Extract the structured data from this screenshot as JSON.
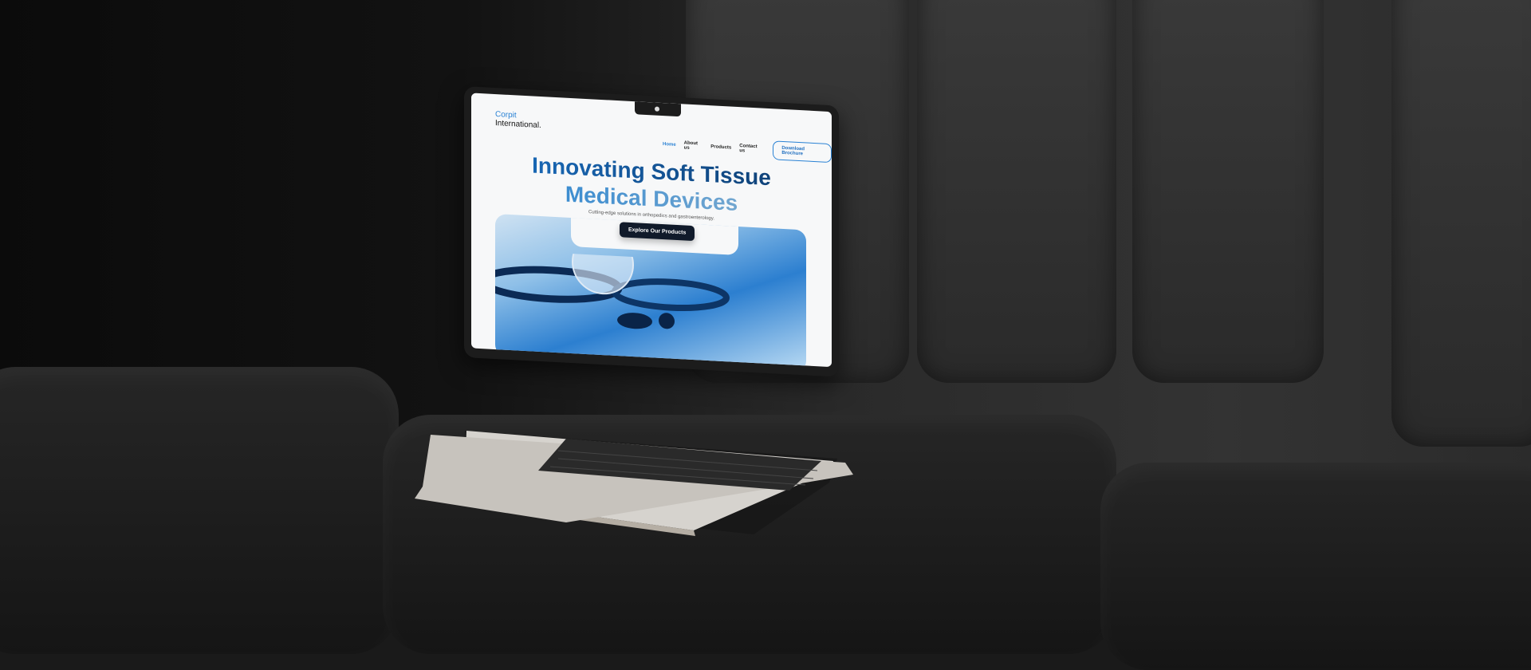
{
  "site": {
    "logo": {
      "line1": "Corpit",
      "line2": "International."
    },
    "nav": {
      "items": [
        "Home",
        "About us",
        "Products",
        "Contact us"
      ],
      "active": "Home",
      "download_label": "Download Brochure"
    },
    "hero": {
      "title_line1": "Innovating Soft Tissue",
      "title_line2": "Medical Devices",
      "subtitle": "Cutting-edge solutions in orthopedics and gastroenterology.",
      "cta_label": "Explore Our Products"
    }
  },
  "colors": {
    "brand_blue": "#2a82d4",
    "dark_navy": "#101a2a"
  }
}
